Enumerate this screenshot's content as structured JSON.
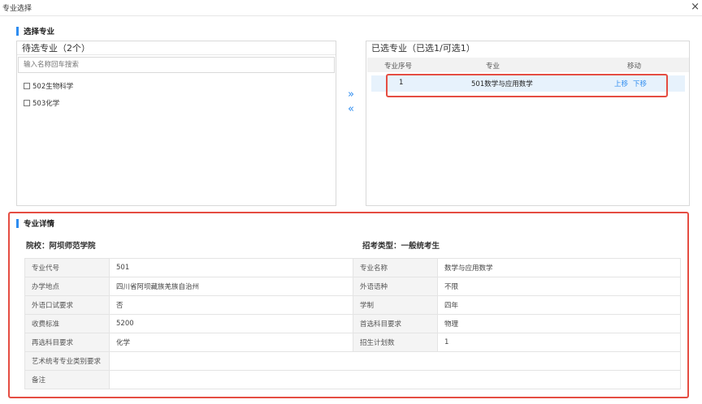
{
  "window": {
    "title": "专业选择",
    "close_icon": "×"
  },
  "select_section": {
    "heading": "选择专业"
  },
  "candidates": {
    "title": "待选专业（2个）",
    "search_placeholder": "输入名称回车搜索",
    "items": [
      "502生物科学",
      "503化学"
    ]
  },
  "transfer": {
    "add": "»",
    "remove": "«"
  },
  "selected": {
    "title": "已选专业（已选1/可选1）",
    "columns": [
      "专业序号",
      "专业",
      "移动"
    ],
    "rows": [
      {
        "index": "1",
        "name": "501数学与应用数学",
        "up": "上移",
        "down": "下移"
      }
    ]
  },
  "detail": {
    "heading": "专业详情",
    "school": "院校：阿坝师范学院",
    "type": "招考类型：一般统考生",
    "rows": [
      {
        "l1": "专业代号",
        "v1": "501",
        "l2": "专业名称",
        "v2": "数学与应用数学"
      },
      {
        "l1": "办学地点",
        "v1": "四川省阿坝藏族羌族自治州",
        "l2": "外语语种",
        "v2": "不限"
      },
      {
        "l1": "外语口试要求",
        "v1": "否",
        "l2": "学制",
        "v2": "四年"
      },
      {
        "l1": "收费标准",
        "v1": "5200",
        "l2": "首选科目要求",
        "v2": "物理"
      },
      {
        "l1": "再选科目要求",
        "v1": "化学",
        "l2": "招生计划数",
        "v2": "1"
      }
    ],
    "art_req_label": "艺术统考专业类别要求",
    "art_req_value": "",
    "remark_label": "备注",
    "remark_value": ""
  },
  "colors": {
    "accent": "#2d8cf0",
    "highlight_border": "#e54d42",
    "selected_row": "#e7f2fc"
  }
}
